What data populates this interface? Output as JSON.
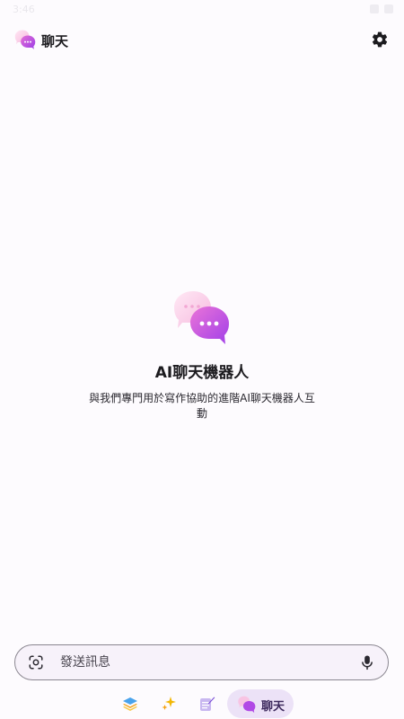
{
  "status_bar": {
    "time": "3:46"
  },
  "app_bar": {
    "title": "聊天",
    "logo_icon": "chat-bubbles-icon",
    "settings_icon": "gear-icon"
  },
  "empty_state": {
    "title": "AI聊天機器人",
    "description": "與我們專門用於寫作協助的進階AI聊天機器人互動"
  },
  "composer": {
    "placeholder": "發送訊息",
    "left_icon": "google-lens-icon",
    "right_icon": "mic-icon"
  },
  "bottom_nav": {
    "items": [
      {
        "icon": "layers-icon",
        "label": ""
      },
      {
        "icon": "sparkle-icon",
        "label": ""
      },
      {
        "icon": "notes-pen-icon",
        "label": ""
      },
      {
        "icon": "chat-bubbles-icon",
        "label": "聊天",
        "selected": true
      }
    ]
  },
  "colors": {
    "background": "#fdfbfe",
    "pink_gradient_start": "#ffd2ea",
    "purple_gradient_end": "#a93ee8",
    "nav_selected": "#ece2f7",
    "composer_bg": "#f7f2fa"
  }
}
